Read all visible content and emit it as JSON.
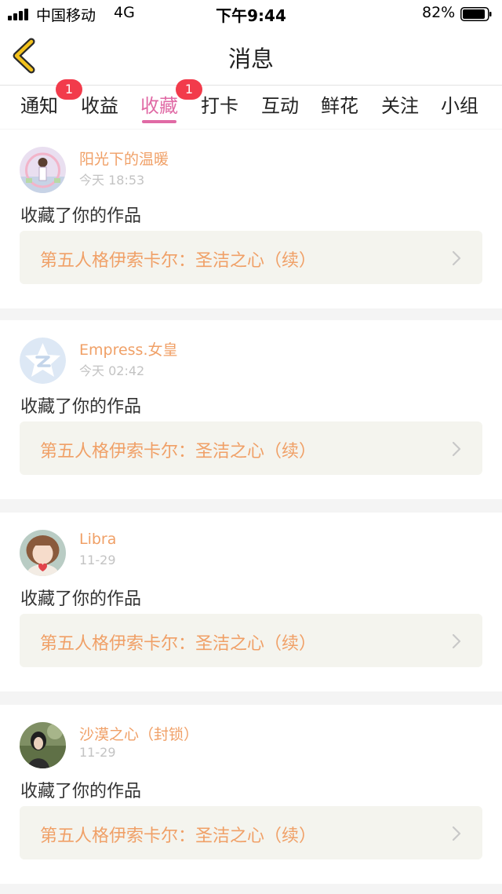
{
  "status_bar": {
    "carrier": "中国移动",
    "network": "4G",
    "time": "下午9:44",
    "battery": "82%"
  },
  "header": {
    "title": "消息"
  },
  "tabs": [
    {
      "label": "通知",
      "badge": "1"
    },
    {
      "label": "收益",
      "badge": ""
    },
    {
      "label": "收藏",
      "badge": "1",
      "active": true
    },
    {
      "label": "打卡",
      "badge": ""
    },
    {
      "label": "互动",
      "badge": ""
    },
    {
      "label": "鲜花",
      "badge": ""
    },
    {
      "label": "关注",
      "badge": ""
    },
    {
      "label": "小组",
      "badge": ""
    }
  ],
  "messages": [
    {
      "username": "阳光下的温暖",
      "time": "今天 18:53",
      "action": "收藏了你的作品",
      "work": "第五人格伊索卡尔：圣洁之心（续）"
    },
    {
      "username": "Empress.女皇",
      "time": "今天 02:42",
      "action": "收藏了你的作品",
      "work": "第五人格伊索卡尔：圣洁之心（续）"
    },
    {
      "username": "Libra",
      "time": "11-29",
      "action": "收藏了你的作品",
      "work": "第五人格伊索卡尔：圣洁之心（续）"
    },
    {
      "username": "沙漠之心（封锁）",
      "time": "11-29",
      "action": "收藏了你的作品",
      "work": "第五人格伊索卡尔：圣洁之心（续）"
    }
  ],
  "colors": {
    "accent": "#e06aa5",
    "badge": "#f23b4b",
    "username": "#f0a067",
    "back_icon": "#f3c21c"
  }
}
